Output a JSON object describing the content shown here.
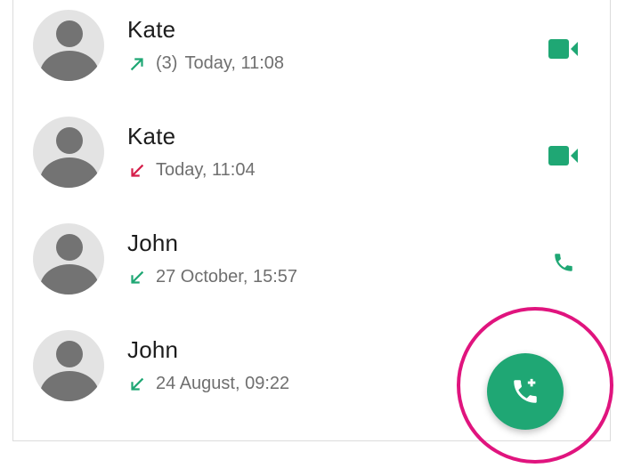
{
  "colors": {
    "accent_green": "#1fa774",
    "missed_red": "#d51e4a",
    "highlight_magenta": "#e0147e"
  },
  "calls": [
    {
      "name": "Kate",
      "direction": "outgoing",
      "count": "(3)",
      "time": "Today, 11:08",
      "type": "video",
      "arrow_icon": "outgoing-call-arrow-icon",
      "action_icon": "video-camera-icon"
    },
    {
      "name": "Kate",
      "direction": "missed",
      "count": "",
      "time": "Today, 11:04",
      "type": "video",
      "arrow_icon": "missed-call-arrow-icon",
      "action_icon": "video-camera-icon"
    },
    {
      "name": "John",
      "direction": "incoming",
      "count": "",
      "time": "27 October, 15:57",
      "type": "voice",
      "arrow_icon": "incoming-call-arrow-icon",
      "action_icon": "phone-icon"
    },
    {
      "name": "John",
      "direction": "incoming",
      "count": "",
      "time": "24 August, 09:22",
      "type": "voice",
      "arrow_icon": "incoming-call-arrow-icon",
      "action_icon": "phone-icon"
    }
  ],
  "fab": {
    "icon": "add-call-icon"
  }
}
